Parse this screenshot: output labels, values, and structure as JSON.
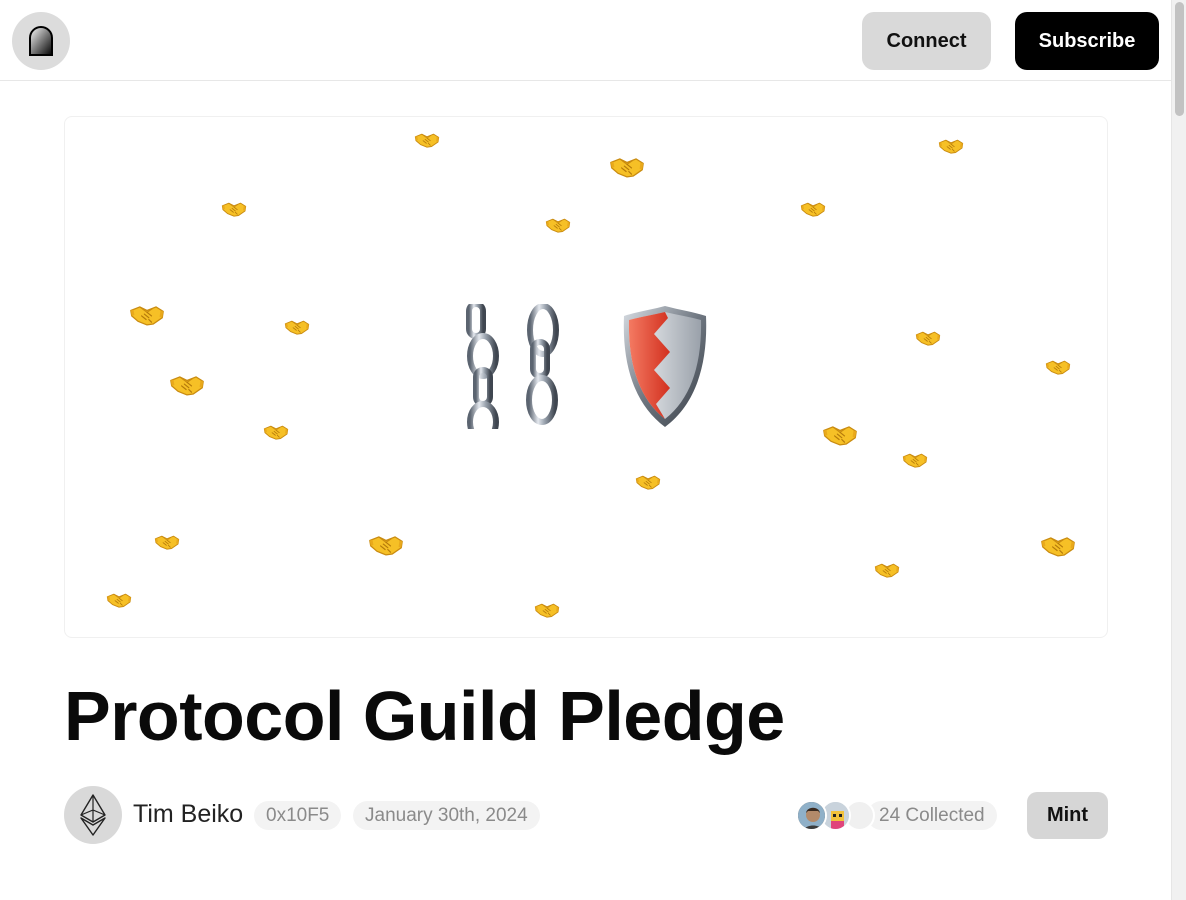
{
  "header": {
    "logo_icon": "arch-door-icon",
    "connect_label": "Connect",
    "subscribe_label": "Subscribe"
  },
  "hero": {
    "icons": [
      "broken-chain-icon",
      "shield-icon",
      "handshake-icon"
    ]
  },
  "post": {
    "title": "Protocol Guild Pledge",
    "author": {
      "name": "Tim Beiko",
      "address": "0x10F5",
      "avatar_icon": "ethereum-icon"
    },
    "date": "January 30th, 2024",
    "collected_label": "24 Collected",
    "mint_label": "Mint"
  },
  "colors": {
    "primary_button_bg": "#000000",
    "secondary_button_bg": "#d9d9d9",
    "pill_bg": "#f3f3f3",
    "pill_text": "#8a8a8a"
  }
}
